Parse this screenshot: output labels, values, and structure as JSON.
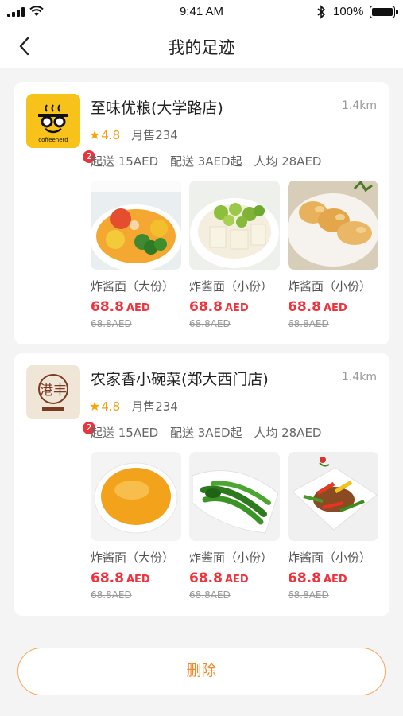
{
  "status_bar": {
    "time": "9:41 AM",
    "battery": "100%",
    "icons": [
      "signal-icon",
      "wifi-icon",
      "bluetooth-icon",
      "battery-icon"
    ]
  },
  "nav": {
    "title": "我的足迹",
    "back_icon": "chevron-left-icon"
  },
  "stores": [
    {
      "name": "至味优粮(大学路店)",
      "distance": "1.4km",
      "logo_text": "coffeenerd",
      "badge": "2",
      "rating": "4.8",
      "monthly_sales": "月售234",
      "min_order": "起送 15AED",
      "delivery_fee": "配送 3AED起",
      "avg_price": "人均 28AED",
      "dishes": [
        {
          "name": "炸酱面（大份）",
          "price": "68.8",
          "currency": "AED",
          "old_price": "68.8AED"
        },
        {
          "name": "炸酱面（小份）",
          "price": "68.8",
          "currency": "AED",
          "old_price": "68.8AED"
        },
        {
          "name": "炸酱面（小份）",
          "price": "68.8",
          "currency": "AED",
          "old_price": "68.8AED"
        }
      ]
    },
    {
      "name": "农家香小碗菜(郑大西门店)",
      "distance": "1.4km",
      "logo_text": "港丰",
      "badge": "2",
      "rating": "4.8",
      "monthly_sales": "月售234",
      "min_order": "起送 15AED",
      "delivery_fee": "配送 3AED起",
      "avg_price": "人均 28AED",
      "dishes": [
        {
          "name": "炸酱面（大份）",
          "price": "68.8",
          "currency": "AED",
          "old_price": "68.8AED"
        },
        {
          "name": "炸酱面（小份）",
          "price": "68.8",
          "currency": "AED",
          "old_price": "68.8AED"
        },
        {
          "name": "炸酱面（小份）",
          "price": "68.8",
          "currency": "AED",
          "old_price": "68.8AED"
        }
      ]
    }
  ],
  "actions": {
    "delete_label": "删除"
  },
  "colors": {
    "accent": "#f28a2a",
    "price": "#f0323c",
    "rating": "#f39c12",
    "badge": "#e7353f"
  }
}
